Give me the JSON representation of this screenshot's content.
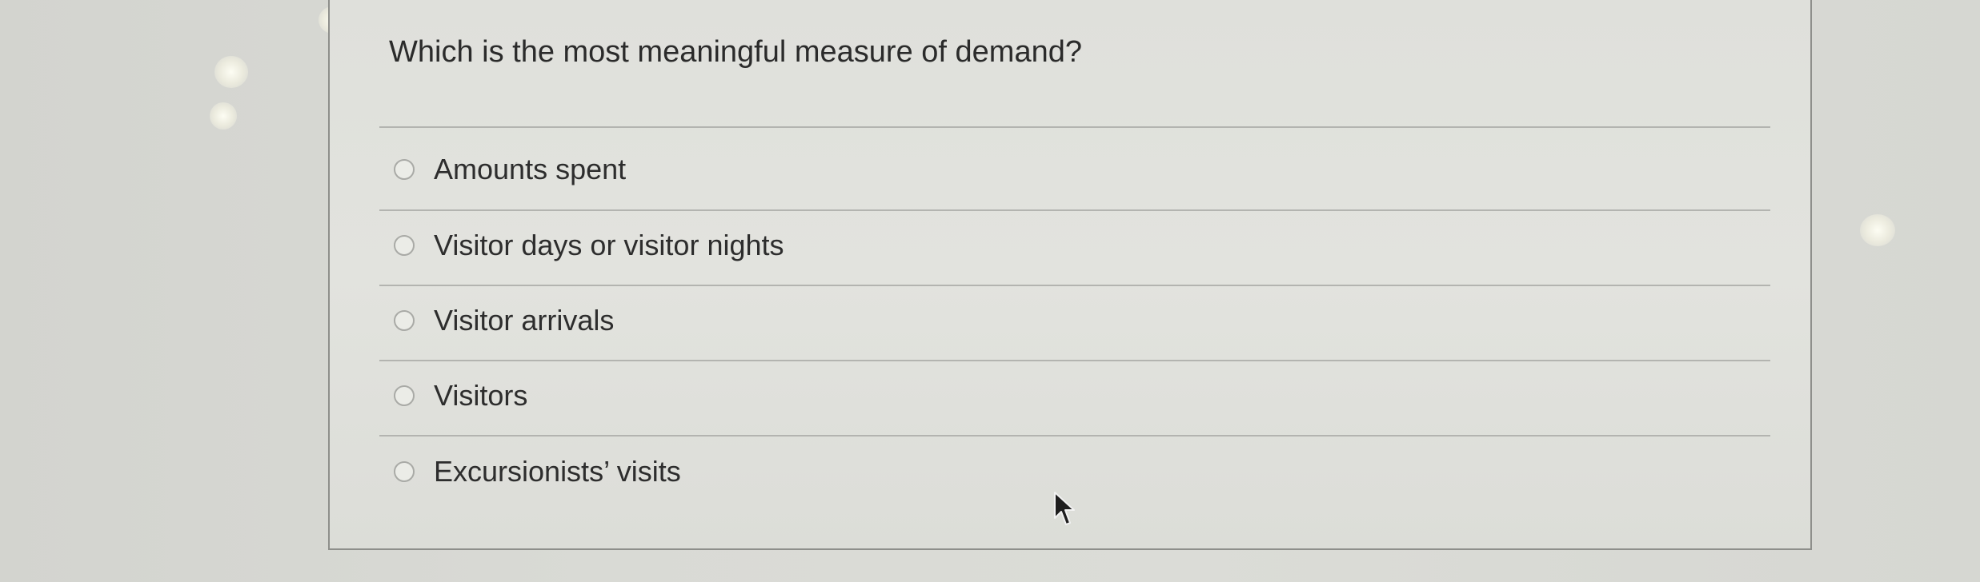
{
  "question": {
    "text": "Which is the most meaningful measure of demand?"
  },
  "options": [
    {
      "label": "Amounts spent",
      "selected": false
    },
    {
      "label": "Visitor days or visitor nights",
      "selected": false
    },
    {
      "label": "Visitor arrivals",
      "selected": false
    },
    {
      "label": "Visitors",
      "selected": false
    },
    {
      "label": "Excursionists’ visits",
      "selected": false
    }
  ],
  "colors": {
    "background": "#d9dad5",
    "card": "#e0e1dc",
    "border": "#8e8f8b",
    "text": "#2b2b2b"
  }
}
